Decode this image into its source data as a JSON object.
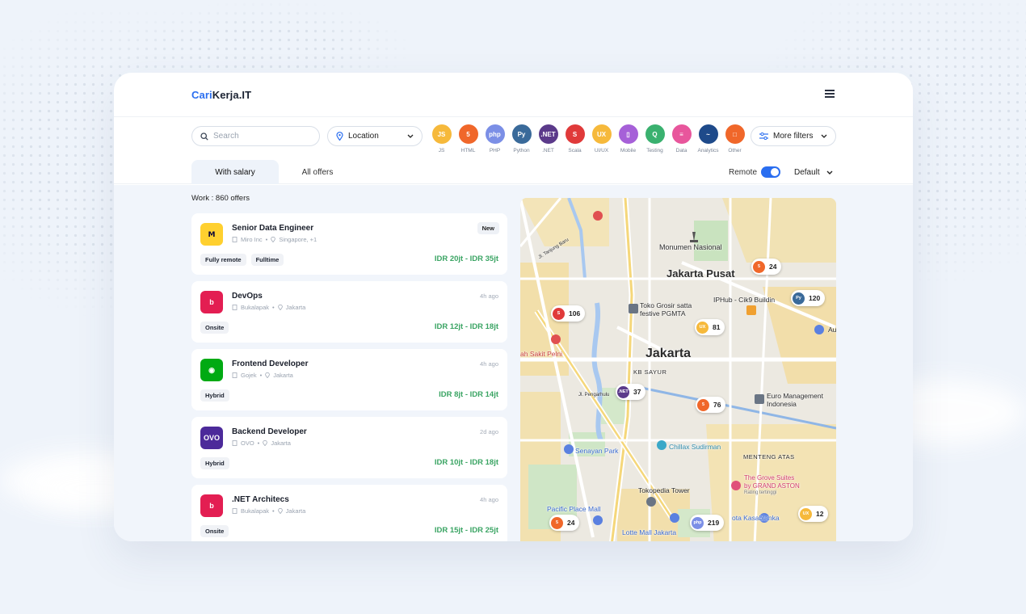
{
  "brand": {
    "part1": "Cari",
    "part2": "Kerja.IT"
  },
  "search": {
    "placeholder": "Search"
  },
  "location": {
    "label": "Location"
  },
  "categories": [
    {
      "label": "JS",
      "color": "#f6b93b",
      "glyph": "JS"
    },
    {
      "label": "HTML",
      "color": "#f0672a",
      "glyph": "5"
    },
    {
      "label": "PHP",
      "color": "#7b8fe6",
      "glyph": "php"
    },
    {
      "label": "Python",
      "color": "#3a6a9a",
      "glyph": "Py"
    },
    {
      "label": ".NET",
      "color": "#5b3a8a",
      "glyph": ".NET"
    },
    {
      "label": "Scala",
      "color": "#e03a3a",
      "glyph": "S"
    },
    {
      "label": "UI/UX",
      "color": "#f6b93b",
      "glyph": "UX"
    },
    {
      "label": "Mobile",
      "color": "#a660d8",
      "glyph": "▯"
    },
    {
      "label": "Testing",
      "color": "#3ab16f",
      "glyph": "Q"
    },
    {
      "label": "Data",
      "color": "#e8569c",
      "glyph": "≡"
    },
    {
      "label": "Analytics",
      "color": "#1e4a8a",
      "glyph": "~"
    },
    {
      "label": "Other",
      "color": "#f0672a",
      "glyph": "□"
    }
  ],
  "more_filters": {
    "label": "More filters"
  },
  "tabs": {
    "with_salary": "With salary",
    "all_offers": "All offers"
  },
  "remote": {
    "label": "Remote",
    "enabled": true
  },
  "sort": {
    "label": "Default"
  },
  "offers_count": "Work : 860 offers",
  "jobs": [
    {
      "title": "Senior Data Engineer",
      "company": "Miro Inc",
      "location": "Singapore, +1",
      "badge": "New",
      "time": "",
      "tags": [
        "Fully remote",
        "Fulltime"
      ],
      "salary": "IDR 20jt - IDR 35jt",
      "logo": "miro"
    },
    {
      "title": "DevOps",
      "company": "Bukalapak",
      "location": "Jakarta",
      "badge": "",
      "time": "4h ago",
      "tags": [
        "Onsite"
      ],
      "salary": "IDR 12jt - IDR 18jt",
      "logo": "bukalapak"
    },
    {
      "title": "Frontend Developer",
      "company": "Gojek",
      "location": "Jakarta",
      "badge": "",
      "time": "4h ago",
      "tags": [
        "Hybrid"
      ],
      "salary": "IDR 8jt - IDR 14jt",
      "logo": "gojek"
    },
    {
      "title": "Backend Developer",
      "company": "OVO",
      "location": "Jakarta",
      "badge": "",
      "time": "2d ago",
      "tags": [
        "Hybrid"
      ],
      "salary": "IDR 10jt - IDR 18jt",
      "logo": "ovo"
    },
    {
      "title": ".NET Architecs",
      "company": "Bukalapak",
      "location": "Jakarta",
      "badge": "",
      "time": "4h ago",
      "tags": [
        "Onsite"
      ],
      "salary": "IDR 15jt - IDR 25jt",
      "logo": "bukalapak"
    }
  ],
  "logo_text": {
    "ovo": "OVO"
  },
  "map": {
    "labels": {
      "city": "Jakarta",
      "pusat": "Jakarta Pusat",
      "monas": "Monumen Nasional",
      "kb_sayur": "KB SAYUR",
      "menteng": "MENTENG ATAS",
      "senayan": "Senayan Park",
      "chillax": "Chillax Sudirman",
      "tokopedia": "Tokopedia Tower",
      "pacific": "Pacific Place Mall",
      "lotte": "Lotte Mall Jakarta",
      "kasablanka": "ota Kasablanka",
      "grove1": "The Grove Suites",
      "grove2": "by GRAND ASTON",
      "grove3": "Rating tertinggi",
      "euro1": "Euro Management",
      "euro2": "Indonesia",
      "iphub": "IPHub - Cik9 Buildin",
      "toko1": "Toko Grosir satta",
      "toko2": "festive PGMTA",
      "sakit": "ah Sakit Pelni",
      "tanjung": "Jl. Tanjung Baru",
      "penghulu": "Jl. Pengarhulu",
      "au": "Au"
    },
    "pins": [
      {
        "count": "24",
        "color": "#f0672a",
        "glyph": "5"
      },
      {
        "count": "106",
        "color": "#e03a3a",
        "glyph": "S"
      },
      {
        "count": "120",
        "color": "#3a6a9a",
        "glyph": "Py"
      },
      {
        "count": "81",
        "color": "#f6b93b",
        "glyph": "UX"
      },
      {
        "count": "37",
        "color": "#5b3a8a",
        "glyph": ".NET"
      },
      {
        "count": "76",
        "color": "#f0672a",
        "glyph": "5"
      },
      {
        "count": "24",
        "color": "#f0672a",
        "glyph": "5"
      },
      {
        "count": "219",
        "color": "#7b8fe6",
        "glyph": "php"
      },
      {
        "count": "12",
        "color": "#f6b93b",
        "glyph": "UX"
      }
    ]
  }
}
